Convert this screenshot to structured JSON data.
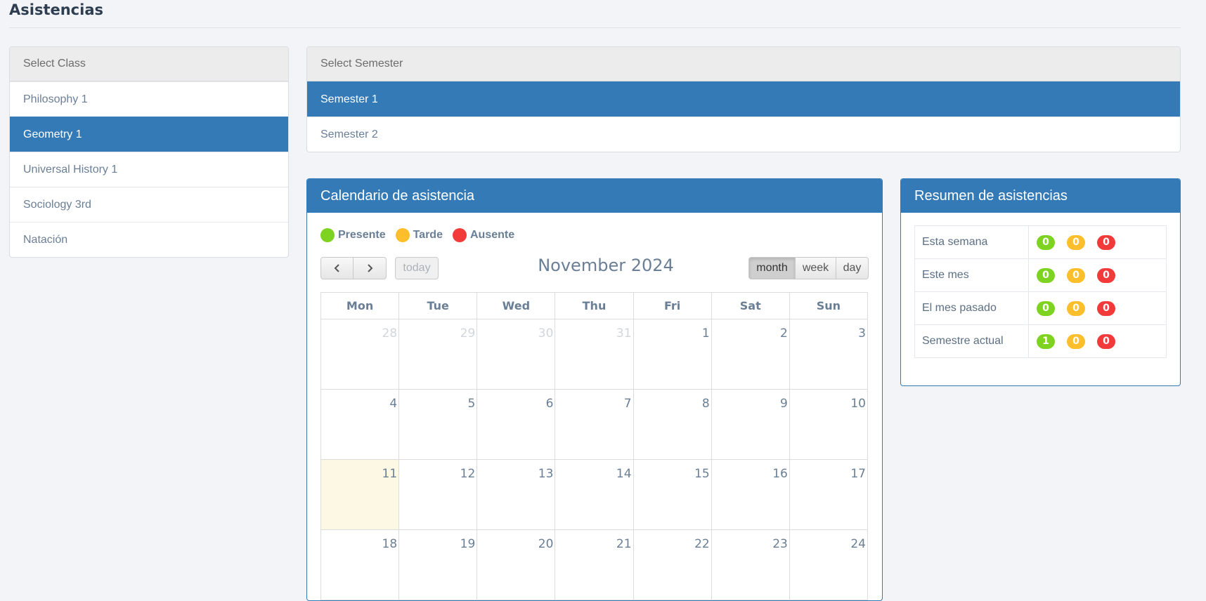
{
  "page": {
    "title": "Asistencias"
  },
  "class_list": {
    "header": "Select Class",
    "items": [
      {
        "label": "Philosophy 1"
      },
      {
        "label": "Geometry 1",
        "active": true
      },
      {
        "label": "Universal History 1"
      },
      {
        "label": "Sociology 3rd"
      },
      {
        "label": "Natación"
      }
    ]
  },
  "semester_list": {
    "header": "Select Semester",
    "items": [
      {
        "label": "Semester 1",
        "active": true
      },
      {
        "label": "Semester 2"
      }
    ]
  },
  "calendar": {
    "heading": "Calendario de asistencia",
    "legend": [
      {
        "label": "Presente",
        "color": "#7ed321"
      },
      {
        "label": "Tarde",
        "color": "#fcbf2b"
      },
      {
        "label": "Ausente",
        "color": "#f23a3a"
      }
    ],
    "title": "November 2024",
    "buttons": {
      "prev_icon": "chevron-left-icon",
      "next_icon": "chevron-right-icon",
      "today": "today",
      "month": "month",
      "week": "week",
      "day": "day"
    },
    "weekdays": [
      "Mon",
      "Tue",
      "Wed",
      "Thu",
      "Fri",
      "Sat",
      "Sun"
    ],
    "weeks": [
      [
        "28",
        "29",
        "30",
        "31",
        "1",
        "2",
        "3"
      ],
      [
        "4",
        "5",
        "6",
        "7",
        "8",
        "9",
        "10"
      ],
      [
        "11",
        "12",
        "13",
        "14",
        "15",
        "16",
        "17"
      ],
      [
        "18",
        "19",
        "20",
        "21",
        "22",
        "23",
        "24"
      ]
    ],
    "other_month_days": [
      "28",
      "29",
      "30",
      "31"
    ],
    "today": "11"
  },
  "summary": {
    "heading": "Resumen de asistencias",
    "rows": [
      {
        "label": "Esta semana",
        "present": "0",
        "late": "0",
        "absent": "0"
      },
      {
        "label": "Este mes",
        "present": "0",
        "late": "0",
        "absent": "0"
      },
      {
        "label": "El mes pasado",
        "present": "0",
        "late": "0",
        "absent": "0"
      },
      {
        "label": "Semestre actual",
        "present": "1",
        "late": "0",
        "absent": "0"
      }
    ],
    "colors": {
      "present": "#7ed321",
      "late": "#fcbf2b",
      "absent": "#f23a3a"
    }
  }
}
